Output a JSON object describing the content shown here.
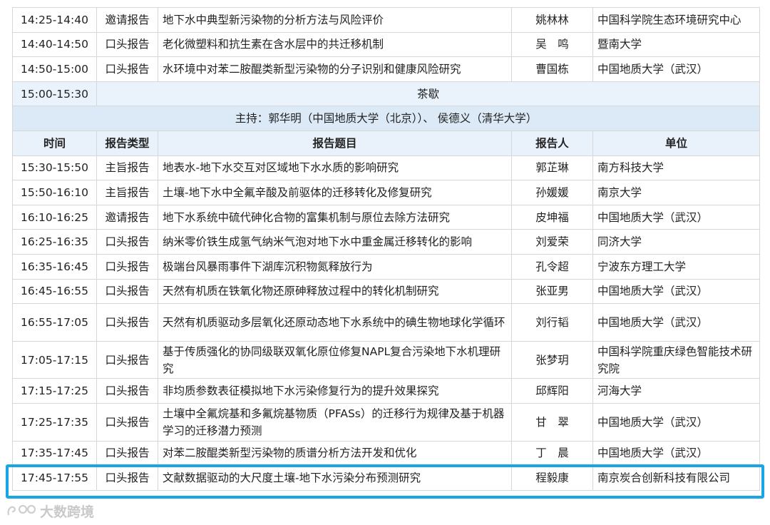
{
  "rows_top": [
    {
      "time": "14:25-14:40",
      "type": "邀请报告",
      "title": "地下水中典型新污染物的分析方法与风险评价",
      "speaker": "姚林林",
      "unit": "中国科学院生态环境研究中心"
    },
    {
      "time": "14:40-14:50",
      "type": "口头报告",
      "title": "老化微塑料和抗生素在含水层中的共迁移机制",
      "speaker": "吴　鸣",
      "unit": "暨南大学"
    },
    {
      "time": "14:50-15:00",
      "type": "口头报告",
      "title": "水环境中对苯二胺醌类新型污染物的分子识别和健康风险研究",
      "speaker": "曹国栋",
      "unit": "中国地质大学（武汉）"
    }
  ],
  "break": {
    "time": "15:00-15:30",
    "label": "茶歇"
  },
  "chair": "主持：郭华明（中国地质大学（北京））、 侯德义（清华大学）",
  "header": {
    "time": "时间",
    "type": "报告类型",
    "title": "报告题目",
    "speaker": "报告人",
    "unit": "单位"
  },
  "rows_bottom": [
    {
      "time": "15:30-15:50",
      "type": "主旨报告",
      "title": "地表水-地下水交互对区域地下水水质的影响研究",
      "speaker": "郭芷琳",
      "unit": "南方科技大学"
    },
    {
      "time": "15:50-16:10",
      "type": "主旨报告",
      "title": "土壤-地下水中全氟辛酸及前驱体的迁移转化及修复研究",
      "speaker": "孙媛媛",
      "unit": "南京大学"
    },
    {
      "time": "16:10-16:25",
      "type": "邀请报告",
      "title": "地下水系统中硫代砷化合物的富集机制与原位去除方法研究",
      "speaker": "皮坤福",
      "unit": "中国地质大学（武汉）"
    },
    {
      "time": "16:25-16:35",
      "type": "口头报告",
      "title": "纳米零价铁生成氢气纳米气泡对地下水中重金属迁移转化的影响",
      "speaker": "刘爱荣",
      "unit": "同济大学"
    },
    {
      "time": "16:35-16:45",
      "type": "口头报告",
      "title": "极端台风暴雨事件下湖库沉积物氮释放行为",
      "speaker": "孔令超",
      "unit": "宁波东方理工大学"
    },
    {
      "time": "16:45-16:55",
      "type": "口头报告",
      "title": "天然有机质在铁氧化物还原砷释放过程中的转化机制研究",
      "speaker": "张亚男",
      "unit": "中国地质大学（武汉）"
    },
    {
      "time": "16:55-17:05",
      "type": "口头报告",
      "title": "天然有机质驱动多层氧化还原动态地下水系统中的碘生物地球化学循环",
      "speaker": "刘行韬",
      "unit": "中国地质大学（武汉）"
    },
    {
      "time": "17:05-17:15",
      "type": "口头报告",
      "title": "基于传质强化的协同级联双氧化原位修复NAPL复合污染地下水机理研究",
      "speaker": "张梦玥",
      "unit": "中国科学院重庆绿色智能技术研究院"
    },
    {
      "time": "17:15-17:25",
      "type": "口头报告",
      "title": "非均质参数表征模拟地下水污染修复行为的提升效果探究",
      "speaker": "邱辉阳",
      "unit": "河海大学"
    },
    {
      "time": "17:25-17:35",
      "type": "口头报告",
      "title": "土壤中全氟烷基和多氟烷基物质（PFASs）的迁移行为规律及基于机器学习的迁移潜力预测",
      "speaker": "甘　翠",
      "unit": "中国地质大学（武汉）"
    },
    {
      "time": "17:35-17:45",
      "type": "口头报告",
      "title": "对苯二胺醌类新型污染物的质谱分析方法开发和优化",
      "speaker": "丁　晨",
      "unit": "中国地质大学（武汉）"
    },
    {
      "time": "17:45-17:55",
      "type": "口头报告",
      "title": "文献数据驱动的大尺度土壤-地下水污染分布预测研究",
      "speaker": "程毅康",
      "unit": "南京炭合创新科技有限公司"
    }
  ],
  "watermark": "大数跨境",
  "colors": {
    "highlight": "#1aa6e6",
    "header_bg": "#e9f1fb",
    "chair_bg": "#dce9f7",
    "border": "#d7d7d7"
  }
}
